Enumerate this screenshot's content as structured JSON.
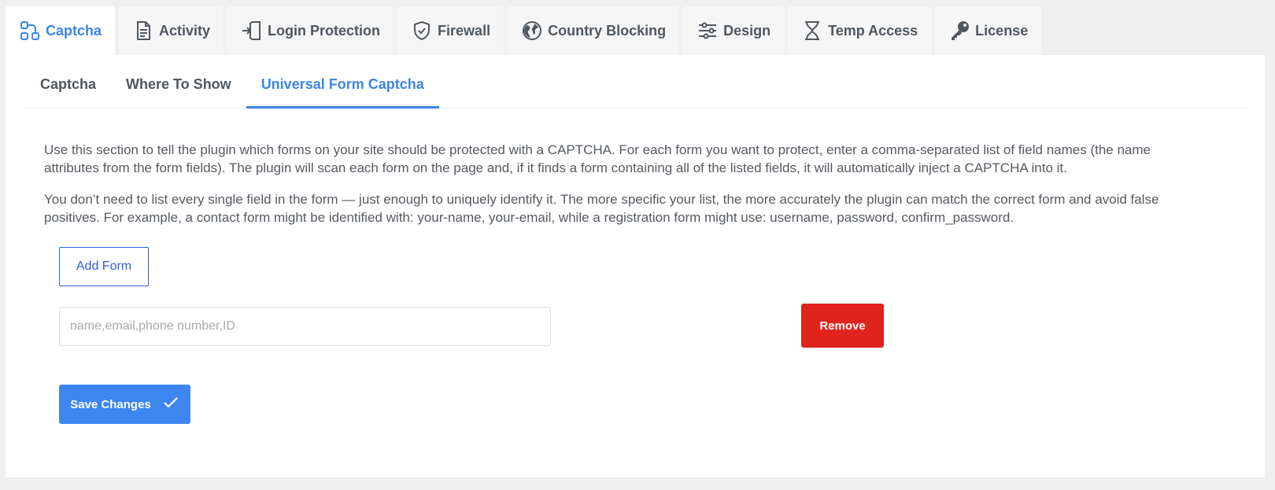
{
  "main_tabs": [
    {
      "label": "Captcha",
      "icon": "captcha-icon",
      "active": true
    },
    {
      "label": "Activity",
      "icon": "document-icon",
      "active": false
    },
    {
      "label": "Login Protection",
      "icon": "login-door-icon",
      "active": false
    },
    {
      "label": "Firewall",
      "icon": "shield-check-icon",
      "active": false
    },
    {
      "label": "Country Blocking",
      "icon": "globe-icon",
      "active": false
    },
    {
      "label": "Design",
      "icon": "sliders-icon",
      "active": false
    },
    {
      "label": "Temp Access",
      "icon": "hourglass-icon",
      "active": false
    },
    {
      "label": "License",
      "icon": "key-icon",
      "active": false
    }
  ],
  "sub_tabs": [
    {
      "label": "Captcha",
      "active": false
    },
    {
      "label": "Where To Show",
      "active": false
    },
    {
      "label": "Universal Form Captcha",
      "active": true
    }
  ],
  "content": {
    "paragraph_1": "Use this section to tell the plugin which forms on your site should be protected with a CAPTCHA. For each form you want to protect, enter a comma-separated list of field names (the name attributes from the form fields). The plugin will scan each form on the page and, if it finds a form containing all of the listed fields, it will automatically inject a CAPTCHA into it.",
    "paragraph_2": "You don’t need to list every single field in the form — just enough to uniquely identify it. The more specific your list, the more accurately the plugin can match the correct form and avoid false positives. For example, a contact form might be identified with: your-name, your-email, while a registration form might use: username, password, confirm_password."
  },
  "form": {
    "add_button_label": "Add Form",
    "field_value": "",
    "field_placeholder": "name,email,phone number,ID",
    "remove_button_label": "Remove",
    "save_button_label": "Save Changes"
  },
  "colors": {
    "accent": "#3c85e6",
    "add_border": "#2f5fe0",
    "remove_bg": "#e0231c",
    "save_bg": "#3d86f0"
  }
}
